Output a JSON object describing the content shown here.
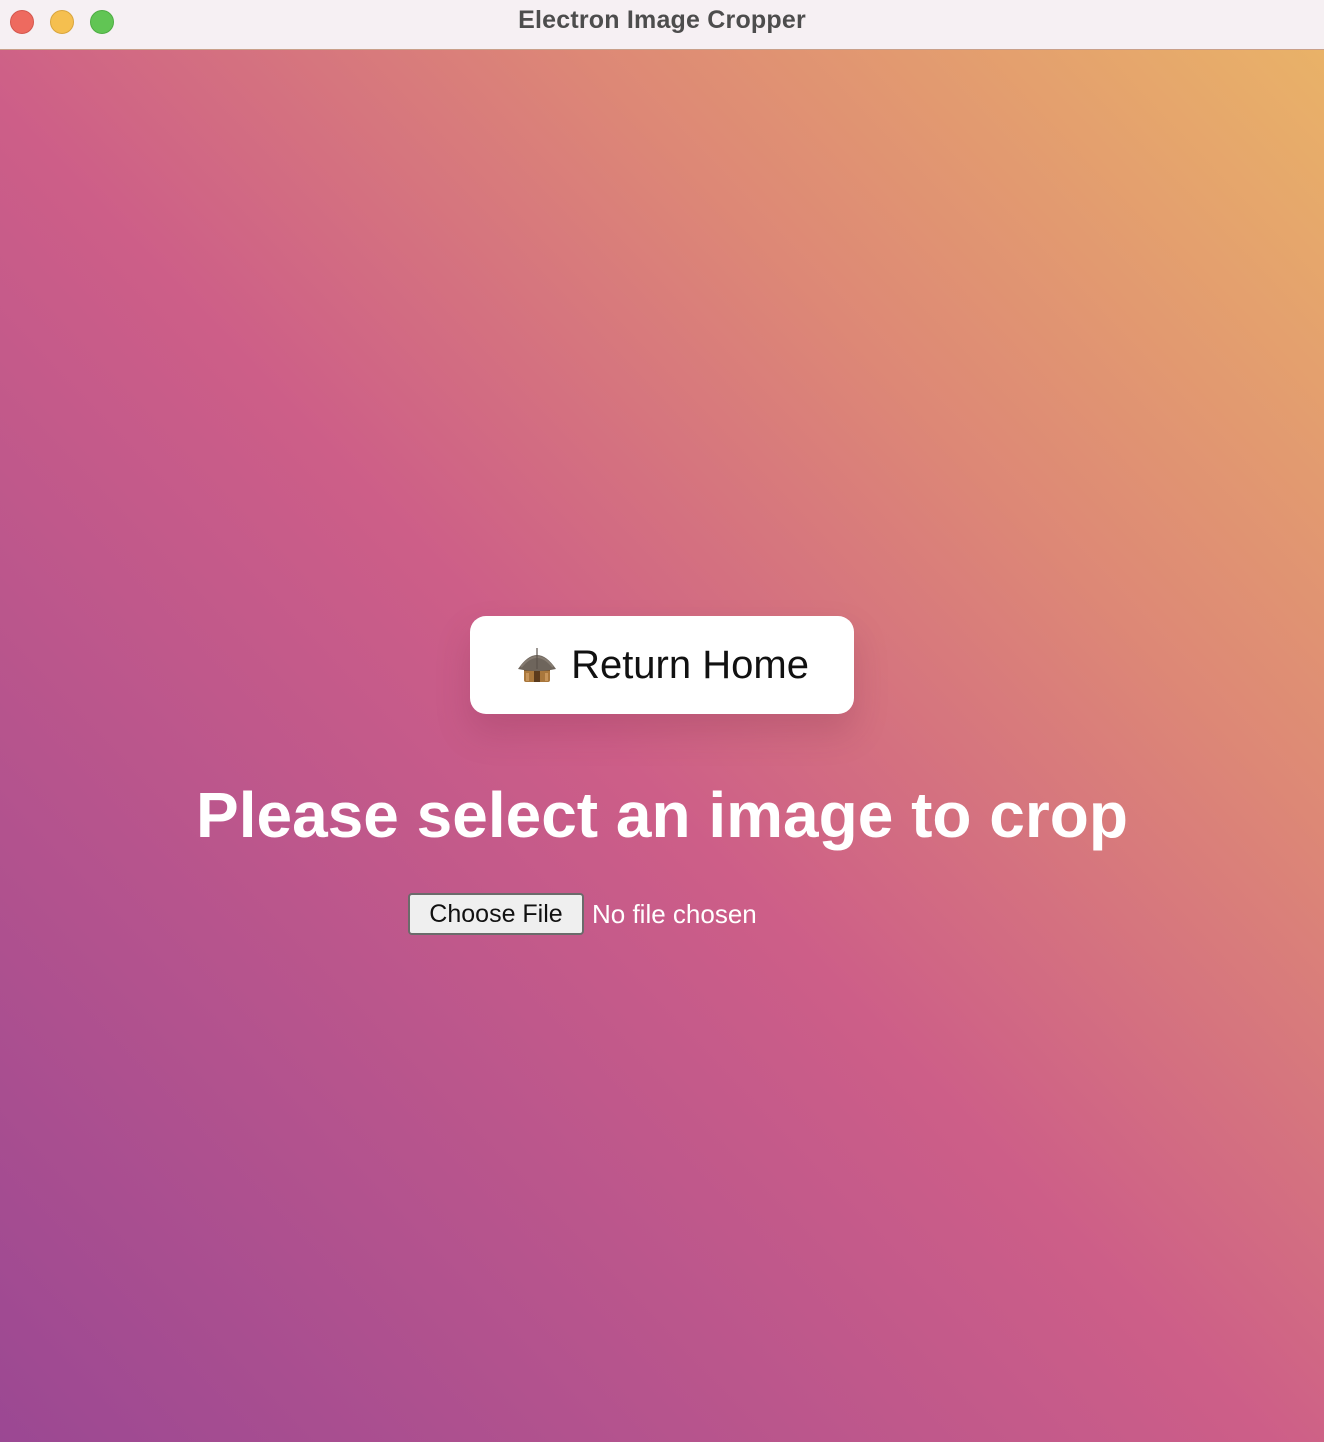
{
  "window": {
    "title": "Electron Image Cropper",
    "controls": [
      "close",
      "minimize",
      "zoom"
    ]
  },
  "home_button": {
    "icon": "hut-icon",
    "label": "Return Home"
  },
  "heading": "Please select an image to crop",
  "file_input": {
    "button_label": "Choose File",
    "status": "No file chosen"
  },
  "colors": {
    "gradient_bottom_left": "#9b4893",
    "gradient_middle": "#cd5e88",
    "gradient_top_right": "#e9b268",
    "title_bar": "#f6f0f3"
  }
}
